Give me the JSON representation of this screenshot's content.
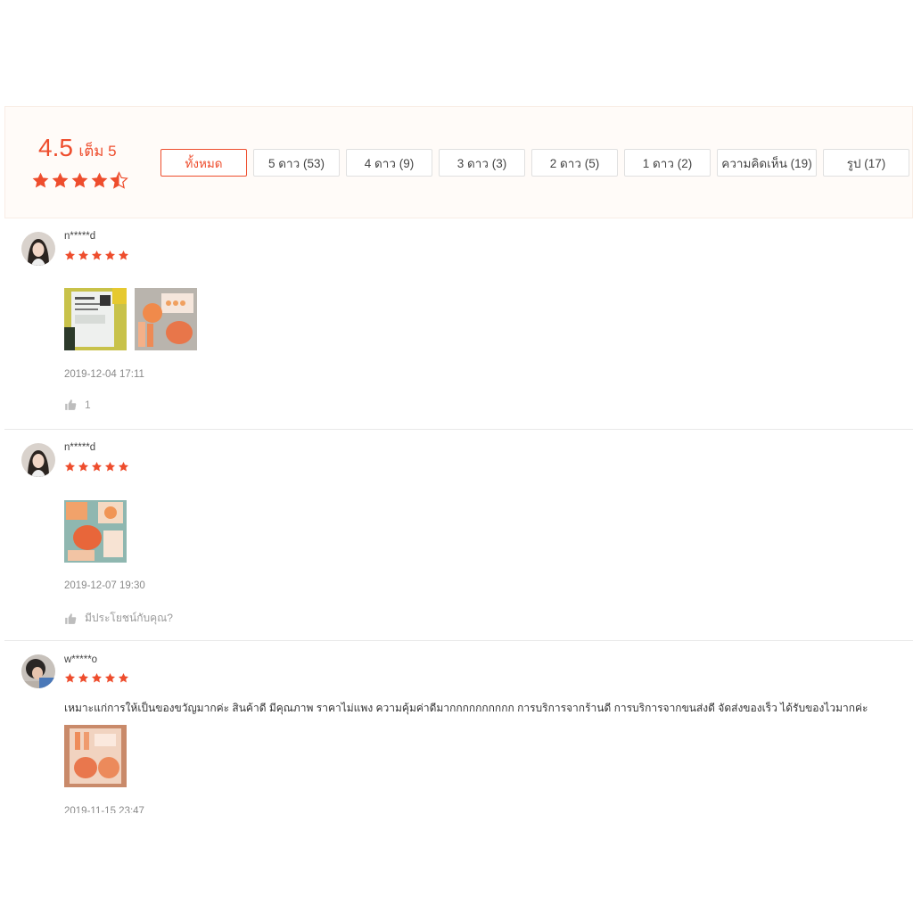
{
  "summary": {
    "score": "4.5",
    "score_suffix": "เต็ม 5",
    "star_fill": 0.5,
    "accent_color": "#ee4d2d"
  },
  "filters": [
    {
      "label": "ทั้งหมด",
      "active": true
    },
    {
      "label": "5 ดาว (53)",
      "active": false
    },
    {
      "label": "4 ดาว (9)",
      "active": false
    },
    {
      "label": "3 ดาว (3)",
      "active": false
    },
    {
      "label": "2 ดาว (5)",
      "active": false
    },
    {
      "label": "1 ดาว (2)",
      "active": false
    },
    {
      "label": "ความคิดเห็น (19)",
      "active": false
    },
    {
      "label": "รูป (17)",
      "active": false
    }
  ],
  "reviews": [
    {
      "username": "n*****d",
      "rating": 5,
      "text": "",
      "photos": [
        "photo-package",
        "photo-products"
      ],
      "date": "2019-12-04 17:11",
      "like_icon": "thumbs-up-icon",
      "likes": "1"
    },
    {
      "username": "n*****d",
      "rating": 5,
      "text": "",
      "photos": [
        "photo-products"
      ],
      "date": "2019-12-07 19:30",
      "like_icon": "thumbs-up-icon",
      "likes": "มีประโยชน์กับคุณ?"
    },
    {
      "username": "w*****o",
      "rating": 5,
      "text": "เหมาะแก่การให้เป็นของขวัญมากค่ะ สินค้าดี มีคุณภาพ ราคาไม่แพง ความคุ้มค่าดีมากกกกกกกกกก การบริการจากร้านดี การบริการจากขนส่งดี จัดส่งของเร็ว ได้รับของไวมากค่ะ",
      "photos": [
        "photo-gift-box"
      ],
      "date": "2019-11-15 23:47"
    }
  ]
}
